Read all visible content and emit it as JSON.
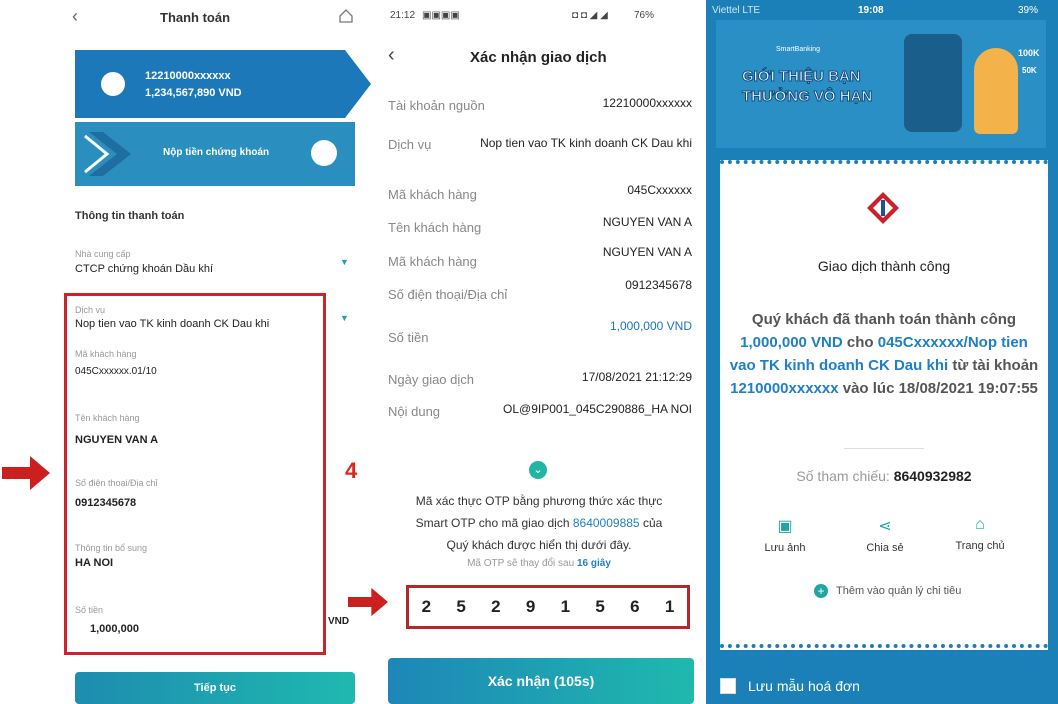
{
  "panel1": {
    "title": "Thanh toán",
    "account": {
      "number": "12210000xxxxxx",
      "balance": "1,234,567,890 VND"
    },
    "service_card_label": "Nộp tiền chứng khoán",
    "section_title": "Thông tin thanh toán",
    "fields": [
      {
        "label": "Nhà cung cấp",
        "value": "CTCP chứng khoán Dầu khí"
      },
      {
        "label": "Dịch vụ",
        "value": "Nop tien vao TK kinh doanh CK Dau khi"
      },
      {
        "label": "Mã khách hàng",
        "value": "045Cxxxxxx.01/10"
      },
      {
        "label": "Tên khách hàng",
        "value": "NGUYEN VAN A"
      },
      {
        "label": "Số điện thoại/Địa chỉ",
        "value": "0912345678"
      },
      {
        "label": "Thông tin bổ sung",
        "value": "HA NOI"
      },
      {
        "label": "Số tiền",
        "value": "1,000,000",
        "unit": "VND"
      }
    ],
    "step_number": "4",
    "continue_label": "Tiếp tục",
    "accent": "#1c78b8",
    "annotation_color": "#c8262c"
  },
  "panel2": {
    "status_time": "21:12",
    "status_right": "76%",
    "title": "Xác nhận giao dịch",
    "rows": [
      {
        "label": "Tài khoản nguồn",
        "value": "12210000xxxxxx"
      },
      {
        "label": "Dịch vụ",
        "value": "Nop tien vao TK kinh doanh CK Dau khi"
      },
      {
        "label": "Mã khách hàng",
        "value": "045Cxxxxxx"
      },
      {
        "label": "Tên khách hàng",
        "value": "NGUYEN VAN A"
      },
      {
        "label": "Mã khách hàng",
        "value": "NGUYEN VAN A"
      },
      {
        "label": "Số điện thoại/Địa chỉ",
        "value": "0912345678"
      },
      {
        "label": "Số tiền",
        "value": "1,000,000 VND"
      },
      {
        "label": "Ngày giao dịch",
        "value": "17/08/2021 21:12:29"
      },
      {
        "label": "Nội dung",
        "value": "OL@9IP001_045C290886_HA NOI"
      }
    ],
    "otp_msg_1": "Mã xác thực OTP bằng phương thức xác thực",
    "otp_msg_2a": "Smart OTP cho mã giao dịch",
    "otp_txn": "8640009885",
    "otp_msg_2b": "của",
    "otp_msg_3": "Quý khách được hiển thị dưới đây.",
    "otp_change_a": "Mã OTP sẽ thay đổi sau",
    "otp_change_b": "16 giây",
    "otp_digits": [
      "2",
      "5",
      "2",
      "9",
      "1",
      "5",
      "6",
      "1"
    ],
    "confirm_label": "Xác nhận (105s)"
  },
  "panel3": {
    "status_carrier": "Viettel  LTE",
    "status_time": "19:08",
    "status_battery": "39%",
    "banner_brand": "SmartBanking",
    "banner_line1": "GIỚI THIỆU BẠN",
    "banner_line2": "THƯỞNG VÔ HẠN",
    "banner_badge_1": "100K",
    "banner_badge_2": "50K",
    "success_title": "Giao dịch thành công",
    "msg_p1": "Quý khách đã thanh toán thành công",
    "msg_amount": "1,000,000 VND",
    "msg_p2": "cho",
    "msg_service": "045Cxxxxxx/Nop tien vao TK kinh doanh CK Dau khi",
    "msg_p3": "từ tài khoản",
    "msg_account": "1210000xxxxxx",
    "msg_p4": "vào lúc",
    "msg_time": "18/08/2021 19:07:55",
    "ref_label": "Số tham chiếu:",
    "ref_value": "8640932982",
    "actions": [
      "Lưu ảnh",
      "Chia sẻ",
      "Trang chủ"
    ],
    "add_expense": "Thêm vào quản lý chi tiêu",
    "save_template": "Lưu mẫu hoá đơn"
  }
}
